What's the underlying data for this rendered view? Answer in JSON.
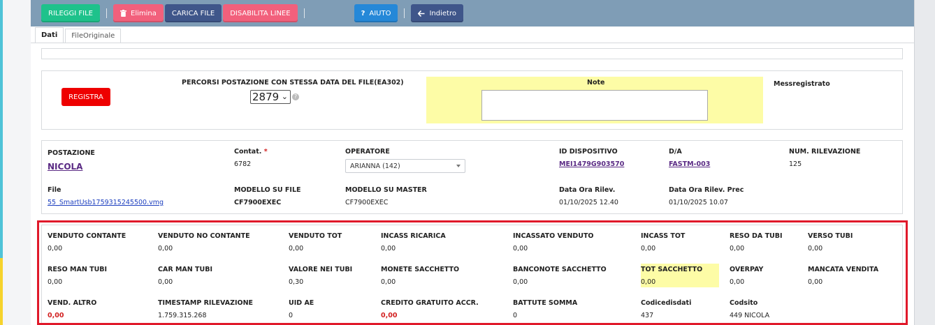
{
  "toolbar": {
    "rileggi": "RILEGGI FILE",
    "elimina": "Elimina",
    "carica": "CARICA FILE",
    "disabilita": "DISABILITA LINEE",
    "aiuto": "AIUTO",
    "indietro": "Indietro",
    "icons": {
      "elimina": "trash-icon",
      "aiuto": "question-icon",
      "indietro": "arrow-left-icon"
    }
  },
  "tabs": [
    {
      "label": "Dati",
      "active": true
    },
    {
      "label": "FileOriginale",
      "active": false
    }
  ],
  "top_panel": {
    "registra": "REGISTRA",
    "percorsi_label": "PERCORSI POSTAZIONE CON STESSA DATA DEL FILE(EA302)",
    "percorsi_value": "2879",
    "note_label": "Note",
    "messregistrato_label": "Messregistrato"
  },
  "info": {
    "postazione_label": "POSTAZIONE",
    "postazione_value": "NICOLA",
    "contat_label": "Contat.",
    "contat_required": "*",
    "contat_value": "6782",
    "operatore_label": "OPERATORE",
    "operatore_value": "ARIANNA (142)",
    "id_dispositivo_label": "ID DISPOSITIVO",
    "id_dispositivo_value": "MEI1479G903570",
    "da_label": "D/A",
    "da_value": "FASTM-003",
    "num_rilevazione_label": "NUM. RILEVAZIONE",
    "num_rilevazione_value": "125",
    "file_label": "File",
    "file_value": "55_SmartUsb1759315245500.vmg",
    "modello_file_label": "MODELLO SU FILE",
    "modello_file_value": "CF7900EXEC",
    "modello_master_label": "MODELLO SU MASTER",
    "modello_master_value": "CF7900EXEC",
    "data_ora_label": "Data Ora Rilev.",
    "data_ora_value": "01/10/2025 12.40",
    "data_ora_prec_label": "Data Ora Rilev. Prec",
    "data_ora_prec_value": "01/10/2025 10.07"
  },
  "totals": {
    "row1": [
      {
        "label": "VENDUTO CONTANTE",
        "value": "0,00"
      },
      {
        "label": "VENDUTO NO CONTANTE",
        "value": "0,00"
      },
      {
        "label": "VENDUTO TOT",
        "value": "0,00"
      },
      {
        "label": "INCASS RICARICA",
        "value": "0,00"
      },
      {
        "label": "INCASSATO VENDUTO",
        "value": "0,00"
      },
      {
        "label": "INCASS TOT",
        "value": "0,00"
      },
      {
        "label": "RESO DA TUBI",
        "value": "0,00"
      },
      {
        "label": "VERSO TUBI",
        "value": "0,00"
      }
    ],
    "row2": [
      {
        "label": "RESO MAN TUBI",
        "value": "0,00"
      },
      {
        "label": "CAR MAN TUBI",
        "value": "0,00"
      },
      {
        "label": "VALORE NEI TUBI",
        "value": "0,30"
      },
      {
        "label": "MONETE SACCHETTO",
        "value": "0,00"
      },
      {
        "label": "BANCONOTE SACCHETTO",
        "value": "0,00"
      },
      {
        "label": "TOT SACCHETTO",
        "value": "0,00"
      },
      {
        "label": "OVERPAY",
        "value": "0,00"
      },
      {
        "label": "MANCATA VENDITA",
        "value": "0,00"
      }
    ],
    "row3": [
      {
        "label": "VEND. ALTRO",
        "value": "0,00"
      },
      {
        "label": "TIMESTAMP RILEVAZIONE",
        "value": "1.759.315.268"
      },
      {
        "label": "UID AE",
        "value": "0"
      },
      {
        "label": "CREDITO GRATUITO ACCR.",
        "value": "0,00"
      },
      {
        "label": "BATTUTE SOMMA",
        "value": "0"
      },
      {
        "label": "Codicedisdati",
        "value": "437"
      },
      {
        "label": "Codsito",
        "value": "449 NICOLA"
      }
    ]
  },
  "colors": {
    "toolbar_bg": "#7f9db6",
    "green": "#1ec28b",
    "pink": "#f2607c",
    "navy": "#3f568a",
    "blue": "#2588d8",
    "registra_red": "#ee0000",
    "highlight_yellow": "#fdfca6",
    "frame_red": "#e0192a"
  }
}
